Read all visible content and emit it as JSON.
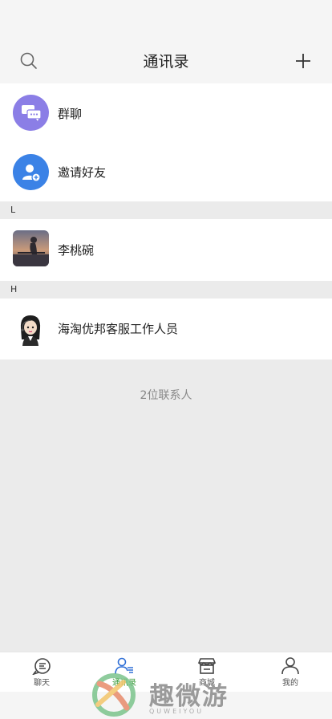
{
  "header": {
    "title": "通讯录",
    "search_icon": "search-icon",
    "add_icon": "plus-icon"
  },
  "actions": [
    {
      "label": "群聊",
      "icon": "group-chat-icon",
      "color": "#8b7ee6"
    },
    {
      "label": "邀请好友",
      "icon": "add-friend-icon",
      "color": "#3b82e6"
    }
  ],
  "sections": [
    {
      "letter": "L",
      "contacts": [
        {
          "name": "李桃碗",
          "avatar": "sunset-portrait"
        }
      ]
    },
    {
      "letter": "H",
      "contacts": [
        {
          "name": "海淘优邦客服工作人员",
          "avatar": "cartoon-support-agent"
        }
      ]
    }
  ],
  "contact_count": "2位联系人",
  "tabbar": {
    "items": [
      {
        "label": "聊天",
        "icon": "chat-icon",
        "active": false
      },
      {
        "label": "通讯录",
        "icon": "contacts-icon",
        "active": true
      },
      {
        "label": "商城",
        "icon": "store-icon",
        "active": false
      },
      {
        "label": "我的",
        "icon": "profile-icon",
        "active": false
      }
    ],
    "active_color": "#3a9b3a"
  },
  "watermark": {
    "text": "趣微游",
    "sub": "QUWEIYOU"
  }
}
